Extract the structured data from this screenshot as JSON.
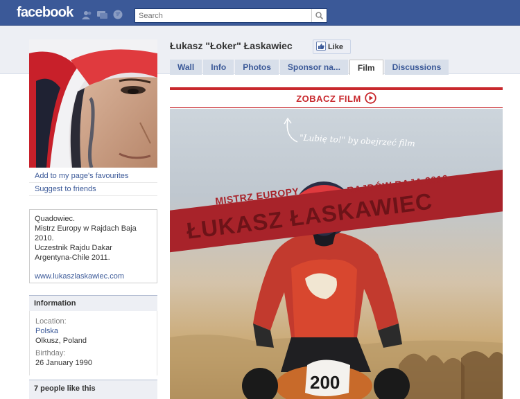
{
  "topbar": {
    "logo": "facebook",
    "search_placeholder": "Search"
  },
  "page": {
    "name": "Łukasz \"Łoker\" Łaskawiec",
    "like_label": "Like"
  },
  "tabs": [
    {
      "label": "Wall",
      "active": false
    },
    {
      "label": "Info",
      "active": false
    },
    {
      "label": "Photos",
      "active": false
    },
    {
      "label": "Sponsor na...",
      "active": false
    },
    {
      "label": "Film",
      "active": true
    },
    {
      "label": "Discussions",
      "active": false
    }
  ],
  "left": {
    "links": [
      "Add to my page's favourites",
      "Suggest to friends"
    ],
    "bio_lines": [
      "Quadowiec.",
      "Mistrz Europy w Rajdach Baja",
      "2010.",
      "Uczestnik Rajdu Dakar",
      "Argentyna-Chile 2011."
    ],
    "bio_url": "www.lukaszlaskawiec.com",
    "info_title": "Information",
    "location_label": "Location:",
    "location_country": "Polska",
    "location_city": "Olkusz, Poland",
    "birthday_label": "Birthday:",
    "birthday_value": "26 January 1990",
    "likes_title": "7 people like this"
  },
  "banner": {
    "zobacz": "ZOBACZ FILM",
    "hint": "\"Lubię to!\" by obejrzeć film",
    "mistrz": "MISTRZ EUROPY",
    "rajdow": "RAJDÓW BAJA 2010",
    "name_big": "ŁUKASZ ŁASKAWIEC",
    "number_plate": "200"
  },
  "colors": {
    "fb_blue": "#3b5998",
    "banner_red": "#c8282d"
  }
}
